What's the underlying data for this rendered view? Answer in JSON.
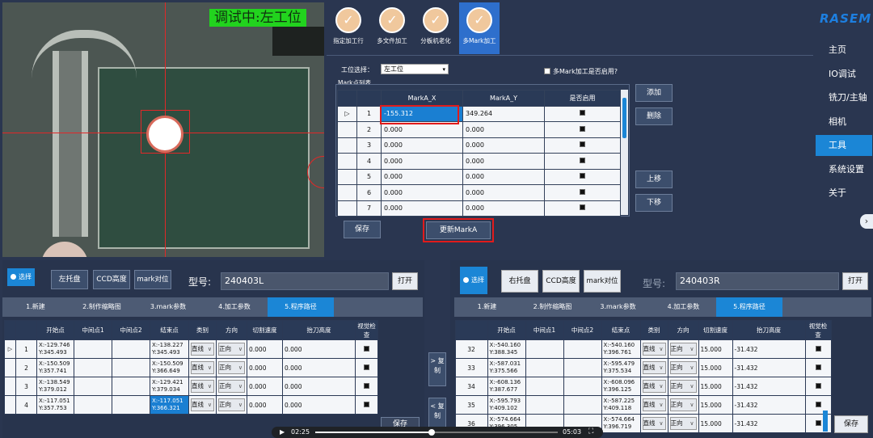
{
  "camera": {
    "status_text": "调试中:左工位"
  },
  "tiles": [
    {
      "label": "指定加工行"
    },
    {
      "label": "多文件加工"
    },
    {
      "label": "分板机老化"
    },
    {
      "label": "多Mark加工"
    }
  ],
  "tile_check": "✓",
  "brand": {
    "logo": "RASEM"
  },
  "nav": [
    {
      "label": "主页"
    },
    {
      "label": "IO调试"
    },
    {
      "label": "铣刀/主轴"
    },
    {
      "label": "相机"
    },
    {
      "label": "工具"
    },
    {
      "label": "系统设置"
    },
    {
      "label": "关于"
    }
  ],
  "nav_active": "工具",
  "mark": {
    "station_label": "工位选择：",
    "station_value": "左工位",
    "multi_label": "多Mark加工是否启用?",
    "list_label": "Mark点列表",
    "columns": [
      "MarkA_X",
      "MarkA_Y",
      "是否启用"
    ],
    "rows": [
      {
        "n": "1",
        "x": "-155.312",
        "y": "349.264"
      },
      {
        "n": "2",
        "x": "0.000",
        "y": "0.000"
      },
      {
        "n": "3",
        "x": "0.000",
        "y": "0.000"
      },
      {
        "n": "4",
        "x": "0.000",
        "y": "0.000"
      },
      {
        "n": "5",
        "x": "0.000",
        "y": "0.000"
      },
      {
        "n": "6",
        "x": "0.000",
        "y": "0.000"
      },
      {
        "n": "7",
        "x": "0.000",
        "y": "0.000"
      }
    ],
    "add": "添加",
    "delete": "删除",
    "up": "上移",
    "down": "下移",
    "save": "保存",
    "update": "更新MarkA"
  },
  "left": {
    "select": "选择",
    "tray": "左托盘",
    "ccd": "CCD高度",
    "mark": "mark对位",
    "model_label": "型号:",
    "model_value": "240403L",
    "open": "打开",
    "tabs": [
      "1.新建",
      "2.制作缩略图",
      "3.mark参数",
      "4.加工参数",
      "5.程序路径"
    ],
    "columns": [
      "开始点",
      "中间点1",
      "中间点2",
      "结束点",
      "类别",
      "方向",
      "切割速度",
      "抬刀高度",
      "视觉检查"
    ],
    "rows": [
      {
        "n": "1",
        "start": "X:-129.746\nY:345.493",
        "end": "X:-138.227\nY:345.493",
        "cat": "直线",
        "dir": "正向",
        "speed": "0.000",
        "lift": "0.000"
      },
      {
        "n": "2",
        "start": "X:-150.509\nY:357.741",
        "end": "X:-150.509\nY:366.649",
        "cat": "直线",
        "dir": "正向",
        "speed": "0.000",
        "lift": "0.000"
      },
      {
        "n": "3",
        "start": "X:-138.549\nY:379.012",
        "end": "X:-129.421\nY:379.034",
        "cat": "直线",
        "dir": "正向",
        "speed": "0.000",
        "lift": "0.000"
      },
      {
        "n": "4",
        "start": "X:-117.051\nY:357.753",
        "end": "X:-117.051\nY:366.321",
        "cat": "直线",
        "dir": "正向",
        "speed": "0.000",
        "lift": "0.000"
      }
    ],
    "save": "保存"
  },
  "copy_right": "> 复制",
  "copy_left": "< 复制",
  "right": {
    "select": "选择",
    "tray": "右托盘",
    "ccd": "CCD高度",
    "mark": "mark对位",
    "model_label": "型号:",
    "model_value": "240403R",
    "open": "打开",
    "tabs": [
      "1.新建",
      "2.制作缩略图",
      "3.mark参数",
      "4.加工参数",
      "5.程序路径"
    ],
    "columns": [
      "开始点",
      "中间点1",
      "中间点2",
      "结束点",
      "类别",
      "方向",
      "切割速度",
      "抬刀高度",
      "视觉检查"
    ],
    "rows": [
      {
        "n": "32",
        "start": "X:-540.160\nY:388.345",
        "end": "X:-540.160\nY:396.761",
        "cat": "直线",
        "dir": "正向",
        "speed": "15.000",
        "lift": "-31.432"
      },
      {
        "n": "33",
        "start": "X:-587.031\nY:375.566",
        "end": "X:-595.479\nY:375.534",
        "cat": "直线",
        "dir": "正向",
        "speed": "15.000",
        "lift": "-31.432"
      },
      {
        "n": "34",
        "start": "X:-608.136\nY:387.677",
        "end": "X:-608.096\nY:396.125",
        "cat": "直线",
        "dir": "正向",
        "speed": "15.000",
        "lift": "-31.432"
      },
      {
        "n": "35",
        "start": "X:-595.793\nY:409.102",
        "end": "X:-587.225\nY:409.118",
        "cat": "直线",
        "dir": "正向",
        "speed": "15.000",
        "lift": "-31.432"
      },
      {
        "n": "36",
        "start": "X:-574.664\nY:396.305",
        "end": "X:-574.664\nY:396.719",
        "cat": "直线",
        "dir": "正向",
        "speed": "15.000",
        "lift": "-31.432"
      }
    ],
    "save": "保存"
  },
  "video": {
    "current": "02:25",
    "total": "05:03",
    "progress": 0.48
  }
}
